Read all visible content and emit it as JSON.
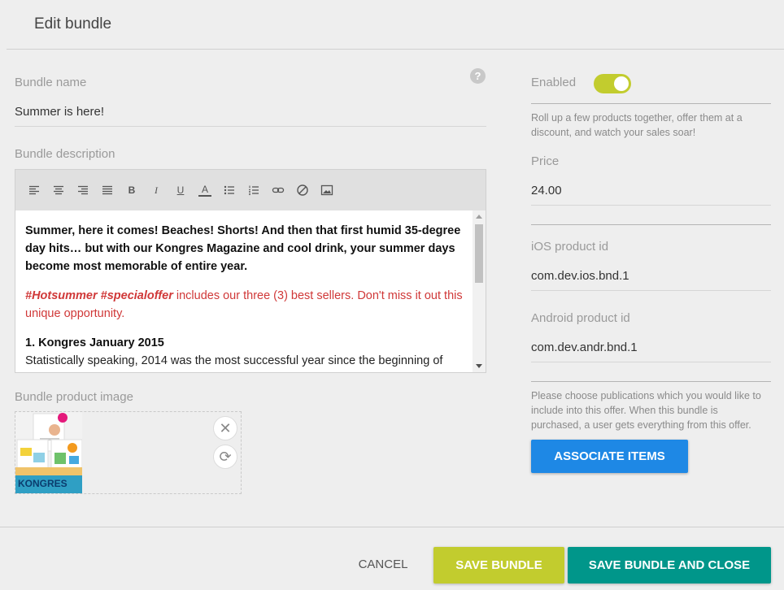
{
  "header": {
    "title": "Edit bundle"
  },
  "form": {
    "bundle_name_label": "Bundle name",
    "bundle_name_value": "Summer is here!",
    "help_icon_glyph": "?",
    "description_label": "Bundle description",
    "description": {
      "p1": "Summer, here it comes! Beaches! Shorts! And then that first humid 35-degree day hits… but with our Kongres Magazine and cool drink, your summer days become most memorable of entire year.",
      "p2_tags": "#Hotsummer #specialoffer",
      "p2_rest": " includes our three (3) best sellers. Don't miss it out this unique opportunity.",
      "h1": "1. Kongres January 2015",
      "p3": "Statistically speaking, 2014 was the most successful year since the beginning of"
    },
    "image_label": "Bundle product image",
    "remove_glyph": "✕",
    "replace_glyph": "⟳",
    "thumb_brand": "KONGRES"
  },
  "toolbar": {
    "icons": [
      "align-left-icon",
      "align-center-icon",
      "align-right-icon",
      "align-justify-icon",
      "bold-icon",
      "italic-icon",
      "underline-icon",
      "font-color-icon",
      "bulleted-list-icon",
      "numbered-list-icon",
      "link-icon",
      "clear-format-icon",
      "image-icon"
    ],
    "bold": "B",
    "italic": "I",
    "underline": "U",
    "font_color": "A"
  },
  "side": {
    "enabled_label": "Enabled",
    "enabled": true,
    "enabled_help": "Roll up a few products together, offer them at a discount, and watch your sales soar!",
    "price_label": "Price",
    "price_value": "24.00",
    "ios_label": "iOS product id",
    "ios_value": "com.dev.ios.bnd.1",
    "android_label": "Android product id",
    "android_value": "com.dev.andr.bnd.1",
    "publications_help": "Please choose publications which you would like to include into this offer. When this bundle is purchased, a user gets everything from this offer.",
    "associate_label": "ASSOCIATE ITEMS"
  },
  "footer": {
    "cancel_label": "CANCEL",
    "save_label": "SAVE BUNDLE",
    "save_close_label": "SAVE BUNDLE AND CLOSE"
  },
  "colors": {
    "accent_lime": "#c2cc2e",
    "accent_teal": "#00968a",
    "accent_blue": "#1e88e5",
    "hashtag_red": "#d03838"
  }
}
